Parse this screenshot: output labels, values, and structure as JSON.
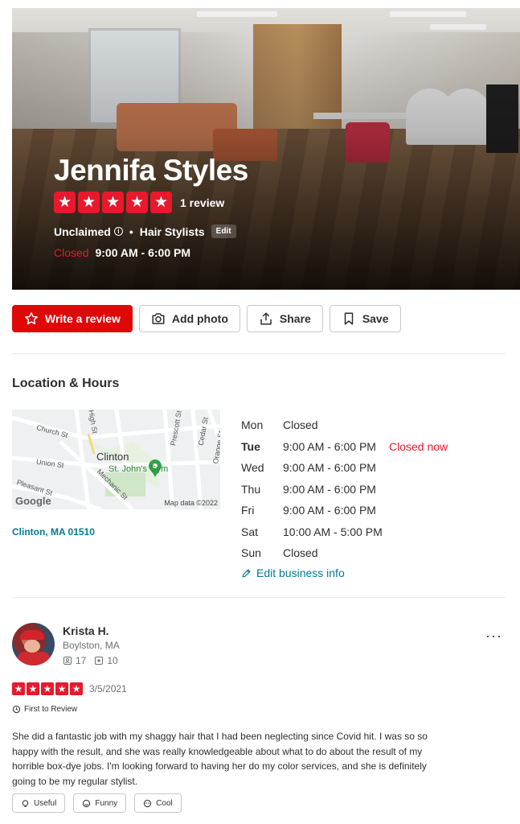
{
  "business": {
    "name": "Jennifa Styles",
    "rating_stars": 5,
    "review_count_text": "1 review",
    "claim_status": "Unclaimed",
    "separator": "•",
    "category": "Hair Stylists",
    "edit_label": "Edit",
    "status": "Closed",
    "today_hours": "9:00 AM - 6:00 PM"
  },
  "actions": {
    "write_review": "Write a review",
    "add_photo": "Add photo",
    "share": "Share",
    "save": "Save"
  },
  "location": {
    "title": "Location & Hours",
    "address": "Clinton, MA 01510",
    "map": {
      "town": "Clinton",
      "poi": "St. John's Gym",
      "streets": [
        "Church St",
        "High St",
        "Union St",
        "Mechanic St",
        "Pleasant St",
        "Prescott St",
        "Cedar St",
        "Orange St"
      ],
      "logo": "Google",
      "copyright": "Map data ©2022"
    },
    "hours": [
      {
        "day": "Mon",
        "time": "Closed",
        "note": ""
      },
      {
        "day": "Tue",
        "time": "9:00 AM - 6:00 PM",
        "note": "Closed now"
      },
      {
        "day": "Wed",
        "time": "9:00 AM - 6:00 PM",
        "note": ""
      },
      {
        "day": "Thu",
        "time": "9:00 AM - 6:00 PM",
        "note": ""
      },
      {
        "day": "Fri",
        "time": "9:00 AM - 6:00 PM",
        "note": ""
      },
      {
        "day": "Sat",
        "time": "10:00 AM - 5:00 PM",
        "note": ""
      },
      {
        "day": "Sun",
        "time": "Closed",
        "note": ""
      }
    ],
    "edit_info": "Edit business info"
  },
  "review": {
    "name": "Krista H.",
    "location": "Boylston, MA",
    "friends": "17",
    "reviews": "10",
    "stars": 5,
    "date": "3/5/2021",
    "badge": "First to Review",
    "more": "···",
    "text": "She did a fantastic job with my shaggy hair that I had been neglecting since Covid hit. I was so so happy with the result, and she was really knowledgeable about what to do about the result of my horrible box-dye jobs. I'm looking forward to having her do my color services, and she is definitely going to be my regular stylist.",
    "reactions": {
      "useful": "Useful",
      "funny": "Funny",
      "cool": "Cool"
    }
  },
  "colors": {
    "brand_red": "#e00707",
    "star_red": "#e8182d",
    "link_teal": "#027a97"
  }
}
